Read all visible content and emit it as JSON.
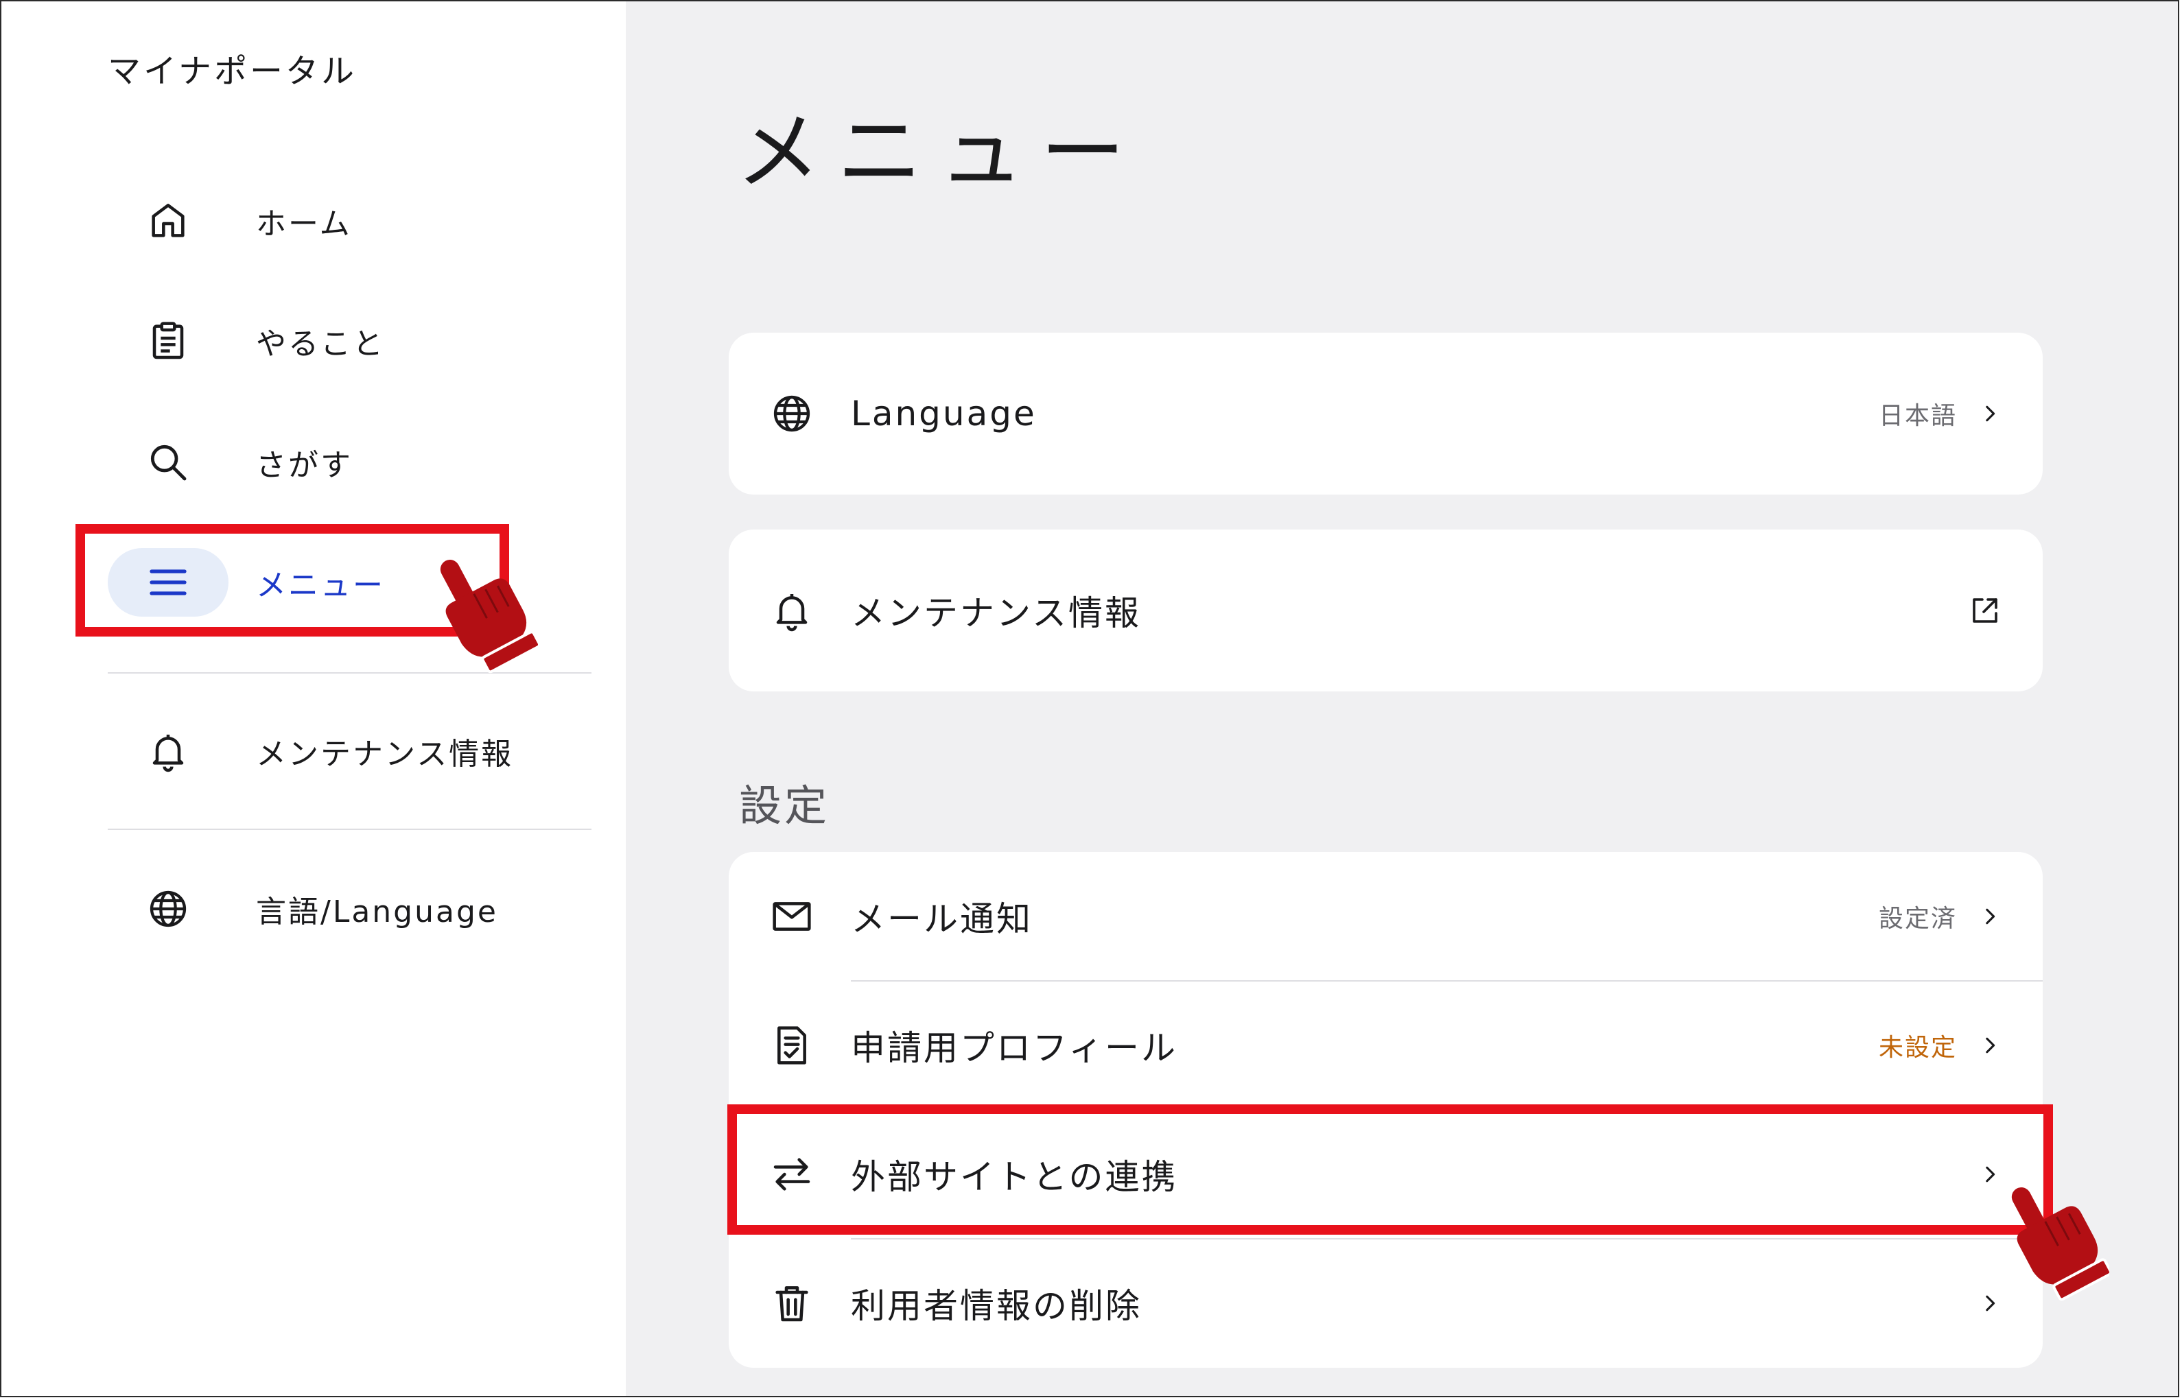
{
  "app": {
    "title": "マイナポータル"
  },
  "sidebar": {
    "items": [
      {
        "label": "ホーム",
        "icon": "home-icon"
      },
      {
        "label": "やること",
        "icon": "clipboard-icon"
      },
      {
        "label": "さがす",
        "icon": "search-icon"
      },
      {
        "label": "メニュー",
        "icon": "hamburger-menu-icon",
        "active": true
      },
      {
        "label": "メンテナンス情報",
        "icon": "bell-icon"
      },
      {
        "label": "言語/Language",
        "icon": "globe-icon"
      }
    ]
  },
  "main": {
    "title": "メニュー",
    "language_row": {
      "label": "Language",
      "value": "日本語",
      "icon": "globe-icon"
    },
    "maintenance_row": {
      "label": "メンテナンス情報",
      "icon": "bell-icon",
      "trailing_icon": "external-link-icon"
    },
    "settings": {
      "section_label": "設定",
      "items": [
        {
          "label": "メール通知",
          "status": "設定済",
          "icon": "mail-icon"
        },
        {
          "label": "申請用プロフィール",
          "status": "未設定",
          "status_color": "#c0650a",
          "icon": "document-check-icon"
        },
        {
          "label": "外部サイトとの連携",
          "status": "",
          "icon": "swap-arrows-icon"
        },
        {
          "label": "利用者情報の削除",
          "status": "",
          "icon": "trash-icon"
        }
      ]
    }
  },
  "colors": {
    "accent": "#1b38c8",
    "active_bg": "#e6edf9",
    "main_bg": "#f0f0f2",
    "highlight": "#e8111b",
    "pointer": "#b30f14"
  }
}
